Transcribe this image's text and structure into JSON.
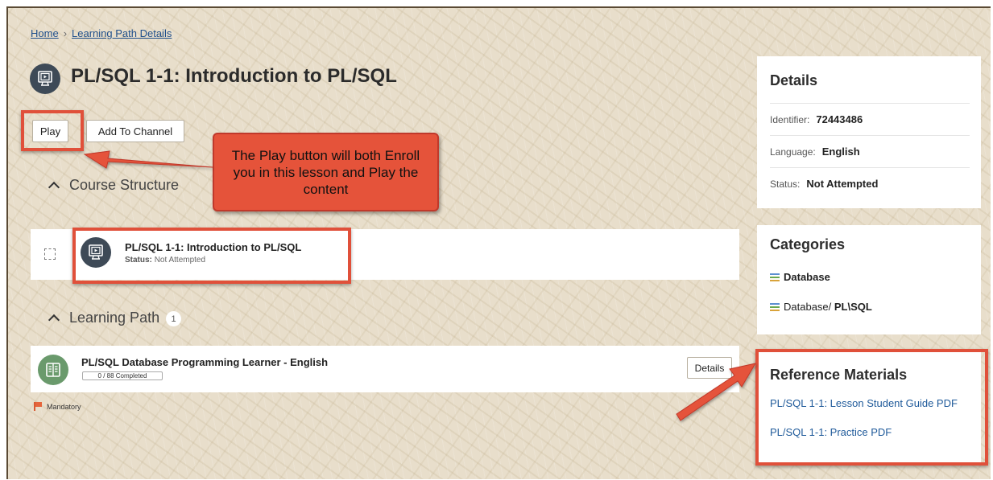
{
  "breadcrumb": {
    "home": "Home",
    "separator": "›",
    "current": "Learning Path Details"
  },
  "header": {
    "title": "PL/SQL 1-1: Introduction to PL/SQL",
    "icon": "monitor-play-icon"
  },
  "actions": {
    "play_label": "Play",
    "add_to_channel_label": "Add To Channel"
  },
  "callout": {
    "text": "The Play button will both Enroll you in this lesson and Play the content"
  },
  "course_structure": {
    "heading": "Course Structure",
    "item": {
      "title": "PL/SQL 1-1: Introduction to PL/SQL",
      "status_label": "Status:",
      "status_value": "Not Attempted"
    }
  },
  "learning_path": {
    "heading": "Learning Path",
    "count": "1",
    "item": {
      "title": "PL/SQL Database Programming Learner - English",
      "progress": "0 / 88 Completed",
      "details_label": "Details"
    },
    "mandatory_label": "Mandatory"
  },
  "details_panel": {
    "title": "Details",
    "identifier_label": "Identifier:",
    "identifier_value": "72443486",
    "language_label": "Language:",
    "language_value": "English",
    "status_label": "Status:",
    "status_value": "Not Attempted"
  },
  "categories_panel": {
    "title": "Categories",
    "items": [
      {
        "prefix": "",
        "bold": "Database"
      },
      {
        "prefix": "Database/ ",
        "bold": "PL\\SQL"
      }
    ]
  },
  "reference_panel": {
    "title": "Reference Materials",
    "links": [
      "PL/SQL 1-1: Lesson Student Guide PDF",
      "PL/SQL 1-1: Practice PDF"
    ]
  },
  "colors": {
    "highlight": "#e0503a",
    "link": "#1f5a9a",
    "background": "#e8decb"
  }
}
